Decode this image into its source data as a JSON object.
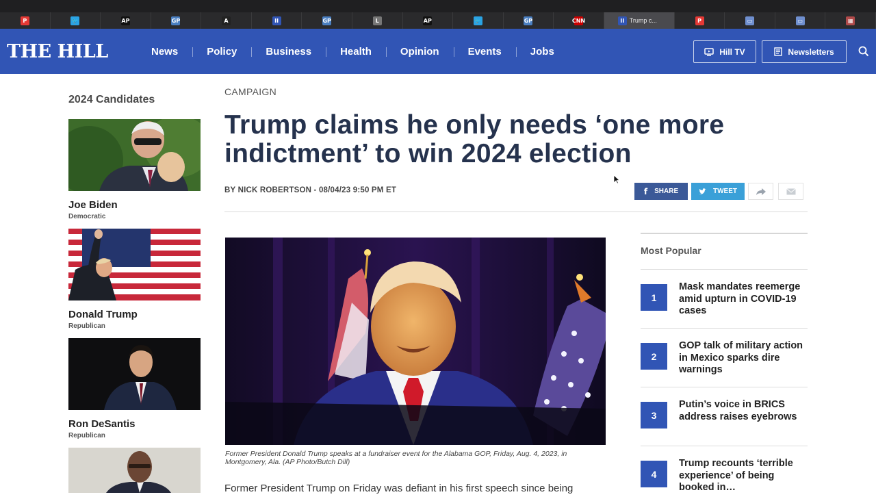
{
  "browser": {
    "tabs": [
      {
        "icon": "p-icon",
        "color": "#e53935",
        "glyph": "P"
      },
      {
        "icon": "twitter-icon",
        "color": "#2aa3e4",
        "glyph": "🐦"
      },
      {
        "icon": "ap-icon",
        "color": "#111111",
        "glyph": "AP"
      },
      {
        "icon": "gp-icon",
        "color": "#4a7fc1",
        "glyph": "GP"
      },
      {
        "icon": "a-icon",
        "color": "#222222",
        "glyph": "A"
      },
      {
        "icon": "hill-icon",
        "color": "#3155b5",
        "glyph": "II"
      },
      {
        "icon": "gp-icon",
        "color": "#4a7fc1",
        "glyph": "GP"
      },
      {
        "icon": "l-icon",
        "color": "#777777",
        "glyph": "L"
      },
      {
        "icon": "ap-icon",
        "color": "#111111",
        "glyph": "AP"
      },
      {
        "icon": "twitter-icon",
        "color": "#2aa3e4",
        "glyph": "🐦"
      },
      {
        "icon": "gp-icon",
        "color": "#4a7fc1",
        "glyph": "GP"
      },
      {
        "icon": "cnn-icon",
        "color": "#cc0000",
        "glyph": "CNN"
      }
    ],
    "active_tab": {
      "icon": "hill-icon",
      "title": "Trump c..."
    },
    "trailing_tabs": [
      {
        "icon": "p-icon",
        "color": "#e53935",
        "glyph": "P"
      },
      {
        "icon": "news-icon",
        "color": "#6f8fcf",
        "glyph": "▭"
      },
      {
        "icon": "news-icon",
        "color": "#6f8fcf",
        "glyph": "▭"
      },
      {
        "icon": "grid-icon",
        "color": "#b04a4a",
        "glyph": "▦"
      }
    ]
  },
  "header": {
    "logo": "THE HILL",
    "nav": [
      "News",
      "Policy",
      "Business",
      "Health",
      "Opinion",
      "Events",
      "Jobs"
    ],
    "hill_tv": "Hill TV",
    "newsletters": "Newsletters",
    "brand_color": "#3155b5"
  },
  "sidebar": {
    "heading": "2024 Candidates",
    "candidates": [
      {
        "name": "Joe Biden",
        "party": "Democratic"
      },
      {
        "name": "Donald Trump",
        "party": "Republican"
      },
      {
        "name": "Ron DeSantis",
        "party": "Republican"
      }
    ]
  },
  "article": {
    "kicker": "CAMPAIGN",
    "headline": "Trump claims he only needs ‘one more indictment’ to win 2024 election",
    "byline": "BY NICK ROBERTSON - 08/04/23 9:50 PM ET",
    "share": {
      "facebook": "SHARE",
      "twitter": "TWEET"
    },
    "caption": "Former President Donald Trump speaks at a fundraiser event for the Alabama GOP, Friday, Aug. 4, 2023, in Montgomery, Ala. (AP Photo/Butch Dill)",
    "lede": "Former President Trump on Friday was defiant in his first speech since being"
  },
  "most_popular": {
    "heading": "Most Popular",
    "items": [
      {
        "rank": "1",
        "title": "Mask mandates reemerge amid upturn in COVID-19 cases"
      },
      {
        "rank": "2",
        "title": "GOP talk of military action in Mexico sparks dire warnings"
      },
      {
        "rank": "3",
        "title": "Putin’s voice in BRICS address raises eyebrows"
      },
      {
        "rank": "4",
        "title": "Trump recounts ‘terrible experience’ of being booked in…"
      }
    ]
  }
}
